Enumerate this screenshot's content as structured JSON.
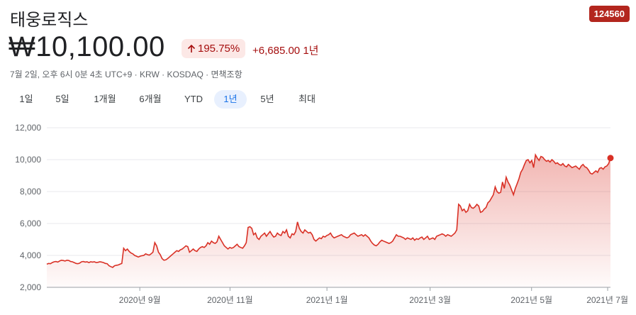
{
  "header": {
    "title": "태웅로직스",
    "ticker": "124560",
    "price": "₩10,100.00",
    "change_pct": "195.75%",
    "change_abs": "+6,685.00 1년",
    "meta": "7월 2일, 오후 6시 0분 4초 UTC+9 · KRW · KOSDAQ · 면책조항",
    "accent_color": "#d93025",
    "up_arrow_icon": "arrow-up-icon"
  },
  "tabs": [
    {
      "label": "1일",
      "active": false
    },
    {
      "label": "5일",
      "active": false
    },
    {
      "label": "1개월",
      "active": false
    },
    {
      "label": "6개월",
      "active": false
    },
    {
      "label": "YTD",
      "active": false
    },
    {
      "label": "1년",
      "active": true
    },
    {
      "label": "5년",
      "active": false
    },
    {
      "label": "최대",
      "active": false
    }
  ],
  "chart_data": {
    "type": "area",
    "title": "",
    "xlabel": "",
    "ylabel": "",
    "ylim": [
      2000,
      12000
    ],
    "yticks": [
      "2,000",
      "4,000",
      "6,000",
      "8,000",
      "10,000",
      "12,000"
    ],
    "xticks": [
      "2020년 9월",
      "2020년 11월",
      "2021년 1월",
      "2021년 3월",
      "2021년 5월",
      "2021년 7월"
    ],
    "grid": true,
    "line_color": "#d93025",
    "series": [
      {
        "values": [
          3450,
          3500,
          3480,
          3550,
          3600,
          3620,
          3580,
          3650,
          3700,
          3680,
          3650,
          3700,
          3680,
          3620,
          3600,
          3550,
          3500,
          3480,
          3520,
          3600,
          3620,
          3580,
          3600,
          3550,
          3600,
          3580,
          3600,
          3550,
          3570,
          3600,
          3580,
          3550,
          3500,
          3480,
          3350,
          3300,
          3250,
          3350,
          3380,
          3400,
          3450,
          3500,
          4450,
          4300,
          4400,
          4250,
          4150,
          4100,
          4000,
          3950,
          3900,
          3950,
          3980,
          4000,
          4100,
          4050,
          4020,
          4100,
          4200,
          4800,
          4600,
          4200,
          4050,
          3800,
          3700,
          3720,
          3800,
          3900,
          4000,
          4100,
          4200,
          4300,
          4250,
          4350,
          4400,
          4500,
          4600,
          4550,
          4200,
          4300,
          4400,
          4300,
          4250,
          4400,
          4500,
          4550,
          4500,
          4600,
          4800,
          4700,
          4900,
          4800,
          4750,
          4850,
          5200,
          5000,
          4800,
          4600,
          4500,
          4400,
          4500,
          4450,
          4500,
          4600,
          4700,
          4550,
          4500,
          4450,
          4600,
          4800,
          5750,
          5800,
          5700,
          5300,
          5400,
          5100,
          5000,
          5200,
          5300,
          5400,
          5200,
          5350,
          5500,
          5300,
          5150,
          5200,
          5400,
          5300,
          5250,
          5500,
          5400,
          5600,
          5200,
          5100,
          5350,
          5300,
          5500,
          6100,
          5700,
          5500,
          5400,
          5600,
          5500,
          5400,
          5450,
          5300,
          5000,
          4900,
          5000,
          5100,
          5050,
          5200,
          5150,
          5250,
          5300,
          5400,
          5200,
          5100,
          5150,
          5200,
          5250,
          5300,
          5200,
          5150,
          5100,
          5150,
          5300,
          5350,
          5400,
          5300,
          5200,
          5250,
          5300,
          5200,
          5300,
          5200,
          5100,
          4900,
          4750,
          4650,
          4600,
          4700,
          4850,
          4950,
          4900,
          4850,
          4800,
          4750,
          4800,
          4900,
          5100,
          5300,
          5200,
          5200,
          5150,
          5100,
          5000,
          5100,
          5050,
          5000,
          5100,
          4950,
          5050,
          5000,
          5100,
          5150,
          5000,
          5100,
          5200,
          5000,
          5050,
          5100,
          5000,
          5200,
          5250,
          5300,
          5350,
          5300,
          5200,
          5300,
          5250,
          5200,
          5300,
          5400,
          5600,
          7200,
          7100,
          6800,
          6900,
          6700,
          6800,
          7200,
          7000,
          6950,
          7050,
          7200,
          7100,
          6700,
          6750,
          6900,
          7000,
          7300,
          7400,
          7600,
          7800,
          8300,
          8000,
          7900,
          7950,
          8600,
          8200,
          8900,
          8600,
          8400,
          8100,
          7800,
          8200,
          8500,
          8800,
          9200,
          9400,
          9700,
          9950,
          10000,
          9800,
          9950,
          9500,
          10300,
          10100,
          9950,
          10200,
          10150,
          10000,
          9900,
          9950,
          9850,
          10000,
          9900,
          9750,
          9800,
          9700,
          9650,
          9750,
          9600,
          9550,
          9700,
          9600,
          9500,
          9550,
          9600,
          9500,
          9400,
          9600,
          9700,
          9550,
          9500,
          9350,
          9150,
          9100,
          9200,
          9300,
          9200,
          9450,
          9500,
          9400,
          9550,
          9600,
          9750,
          10100
        ]
      }
    ]
  }
}
